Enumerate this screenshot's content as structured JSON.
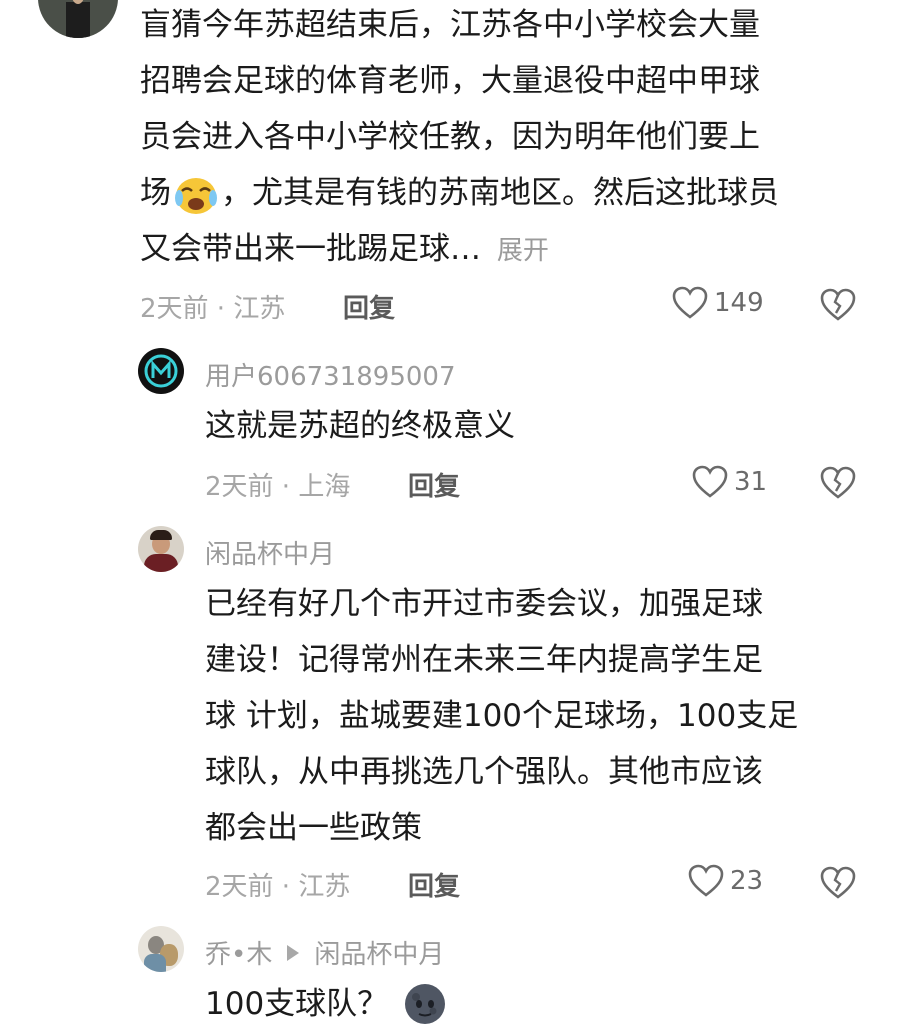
{
  "comments": [
    {
      "text_lines": [
        "盲猜今年苏超结束后，江苏各中小学校会大量",
        "招聘会足球的体育老师，大量退役中超中甲球",
        "员会进入各中小学校任教，因为明年他们要上",
        "场",
        "，尤其是有钱的苏南地区。然后这批球员",
        "又会带出来一批踢足球…"
      ],
      "expand_label": "展开",
      "meta": "2天前 · 江苏",
      "reply_label": "回复",
      "likes": "149",
      "emoji_icon": "crying-laughing-face-icon"
    },
    {
      "username": "用户606731895007",
      "text": "这就是苏超的终极意义",
      "meta": "2天前 · 上海",
      "reply_label": "回复",
      "likes": "31"
    },
    {
      "username": "闲品杯中月",
      "text_lines": [
        "已经有好几个市开过市委会议，加强足球",
        "建设！记得常州在未来三年内提高学生足",
        "球 计划，盐城要建100个足球场，100支足",
        "球队，从中再挑选几个强队。其他市应该",
        "都会出一些政策"
      ],
      "meta": "2天前 · 江苏",
      "reply_label": "回复",
      "likes": "23"
    },
    {
      "username": "乔•木",
      "reply_to": "闲品杯中月",
      "text": "100支球队？",
      "emoji_icon": "dark-moon-face-icon"
    }
  ],
  "colors": {
    "text": "#1b1b1b",
    "meta": "#a6a6a6",
    "reply": "#5a5a5a"
  }
}
